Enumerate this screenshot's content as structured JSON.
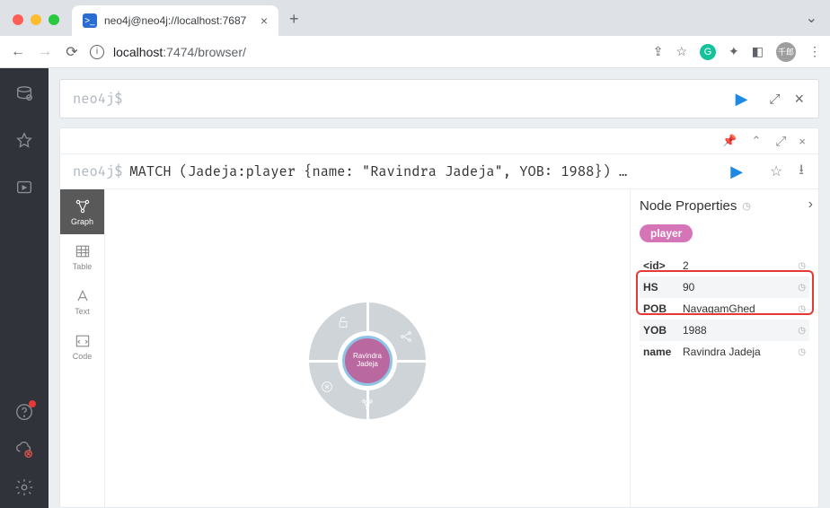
{
  "browser": {
    "tab_title": "neo4j@neo4j://localhost:7687",
    "url_host": "localhost",
    "url_rest": ":7474/browser/",
    "avatar_text": "千郎"
  },
  "editor": {
    "prompt": "neo4j$",
    "query": ""
  },
  "result": {
    "prompt": "neo4j$",
    "query": "MATCH (Jadeja:player {name: \"Ravindra Jadeja\", YOB: 1988}) …",
    "view_tabs": {
      "graph": "Graph",
      "table": "Table",
      "text": "Text",
      "code": "Code"
    },
    "node_label": "Ravindra Jadeja"
  },
  "props": {
    "title": "Node Properties",
    "chip": "player",
    "rows": [
      {
        "key": "<id>",
        "value": "2"
      },
      {
        "key": "HS",
        "value": "90"
      },
      {
        "key": "POB",
        "value": "NavagamGhed"
      },
      {
        "key": "YOB",
        "value": "1988"
      },
      {
        "key": "name",
        "value": "Ravindra Jadeja"
      }
    ]
  }
}
